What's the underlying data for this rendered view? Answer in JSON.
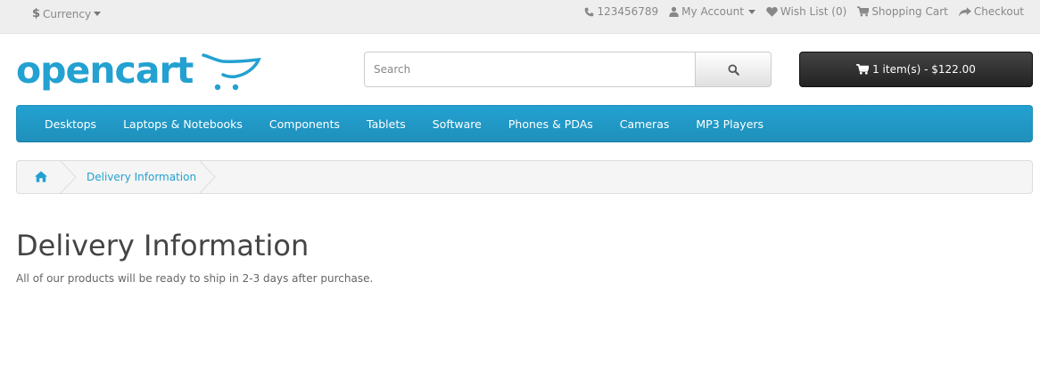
{
  "topbar": {
    "currency_symbol": "$",
    "currency_label": "Currency",
    "phone": "123456789",
    "my_account": "My Account",
    "wish_list": "Wish List (0)",
    "shopping_cart": "Shopping Cart",
    "checkout": "Checkout"
  },
  "header": {
    "logo_text": "opencart",
    "search_placeholder": "Search",
    "search_value": "",
    "cart_label": "1 item(s) - $122.00"
  },
  "menu": {
    "items": [
      "Desktops",
      "Laptops & Notebooks",
      "Components",
      "Tablets",
      "Software",
      "Phones & PDAs",
      "Cameras",
      "MP3 Players"
    ]
  },
  "breadcrumb": {
    "current": "Delivery Information"
  },
  "content": {
    "title": "Delivery Information",
    "text": "All of our products will be ready to ship in 2-3 days after purchase."
  },
  "colors": {
    "accent": "#23a1d1",
    "cart_button": "#333333",
    "topbar_bg": "#eeeeee"
  },
  "icons": [
    "caret-down-icon",
    "phone-icon",
    "user-icon",
    "heart-icon",
    "cart-icon",
    "share-icon",
    "search-icon",
    "home-icon"
  ]
}
